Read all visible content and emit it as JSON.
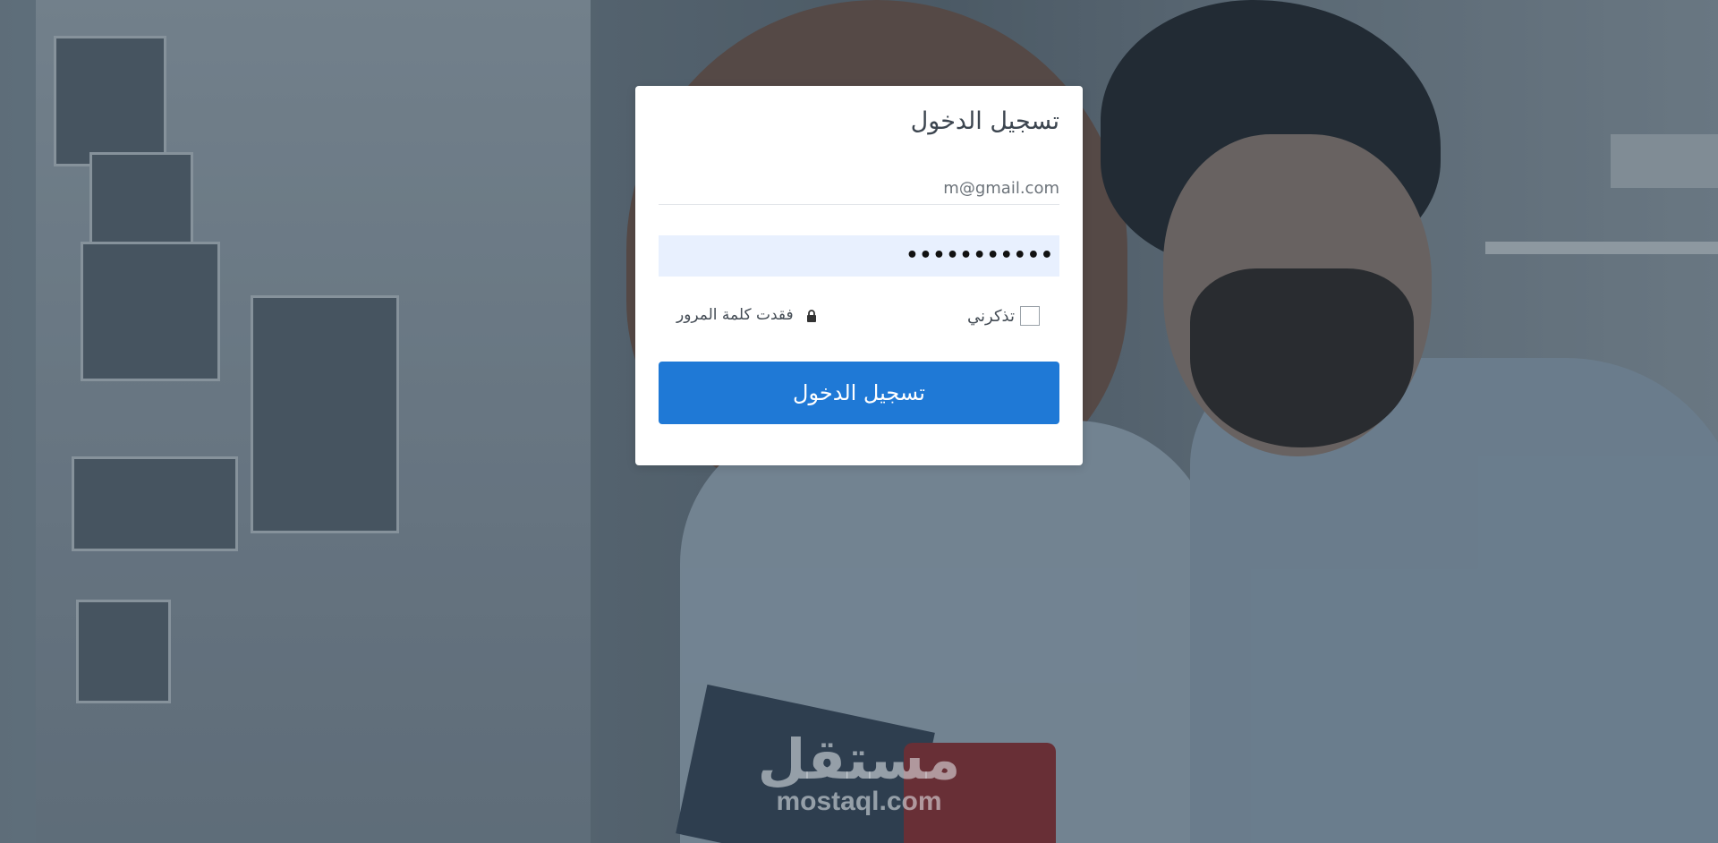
{
  "login": {
    "title": "تسجيل الدخول",
    "email_value": "m@gmail.com",
    "password_masked": "•••••••••••",
    "remember_label": "تذكرني",
    "remember_checked": false,
    "forgot_label": "فقدت كلمة المرور",
    "submit_label": "تسجيل الدخول",
    "accent_color": "#1f79d6",
    "password_bg_color": "#e8f0fe"
  },
  "watermark": {
    "arabic": "مستقل",
    "latin": "mostaql.com"
  },
  "icons": {
    "forgot": "lock-icon"
  }
}
